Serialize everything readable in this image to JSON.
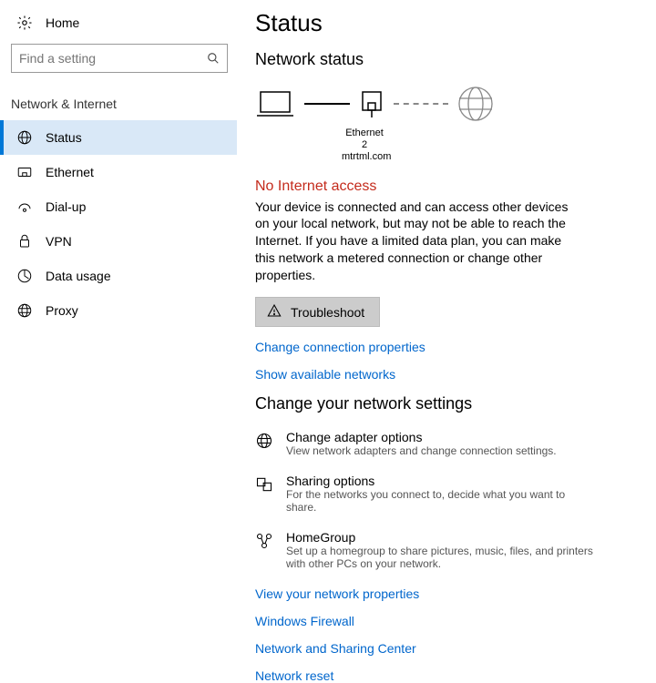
{
  "home": {
    "label": "Home"
  },
  "search": {
    "placeholder": "Find a setting"
  },
  "section": {
    "label": "Network & Internet"
  },
  "nav": [
    {
      "label": "Status"
    },
    {
      "label": "Ethernet"
    },
    {
      "label": "Dial-up"
    },
    {
      "label": "VPN"
    },
    {
      "label": "Data usage"
    },
    {
      "label": "Proxy"
    }
  ],
  "page": {
    "title": "Status",
    "network_status": "Network status",
    "adapter_name": "Ethernet 2",
    "adapter_domain": "mtrtml.com",
    "error_heading": "No Internet access",
    "error_body": "Your device is connected and can access other devices on your local network, but may not be able to reach the Internet. If you have a limited data plan, you can make this network a metered connection or change other properties.",
    "troubleshoot": "Troubleshoot",
    "link_change_props": "Change connection properties",
    "link_show_networks": "Show available networks",
    "change_settings_heading": "Change your network settings",
    "settings": [
      {
        "title": "Change adapter options",
        "desc": "View network adapters and change connection settings."
      },
      {
        "title": "Sharing options",
        "desc": "For the networks you connect to, decide what you want to share."
      },
      {
        "title": "HomeGroup",
        "desc": "Set up a homegroup to share pictures, music, files, and printers with other PCs on your network."
      }
    ],
    "link_view_props": "View your network properties",
    "link_firewall": "Windows Firewall",
    "link_sharing_center": "Network and Sharing Center",
    "link_reset": "Network reset"
  }
}
